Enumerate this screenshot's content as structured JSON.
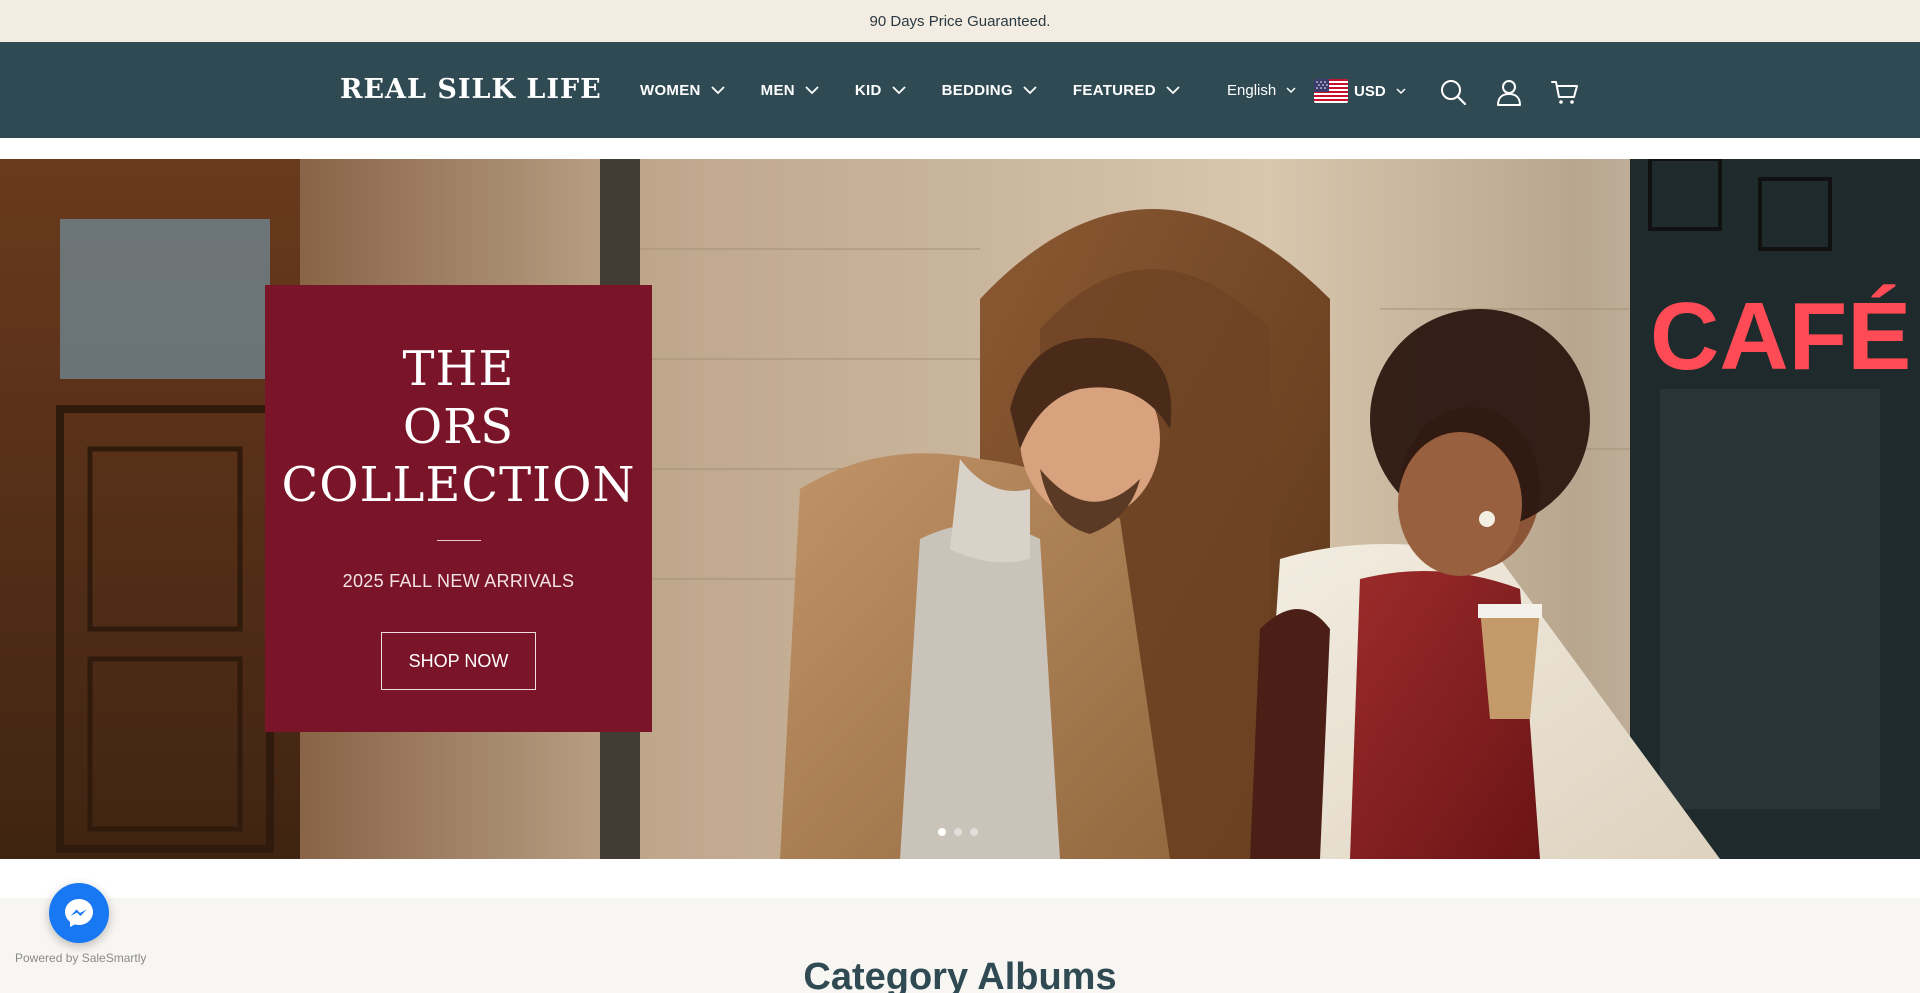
{
  "announcement": {
    "text": "90 Days Price Guaranteed."
  },
  "header": {
    "logo": "REAL SILK LIFE",
    "nav": [
      {
        "label": "WOMEN"
      },
      {
        "label": "MEN"
      },
      {
        "label": "KID"
      },
      {
        "label": "BEDDING"
      },
      {
        "label": "FEATURED"
      }
    ],
    "language": "English",
    "currency": "USD",
    "icons": [
      "search-icon",
      "account-icon",
      "cart-icon"
    ]
  },
  "hero": {
    "title_lines": [
      "THE",
      "ORS",
      "COLLECTION"
    ],
    "subtitle": "2025 FALL NEW ARRIVALS",
    "cta": "SHOP NOW",
    "sign_text": "CAFÉ",
    "slides_total": 3,
    "active_slide": 1
  },
  "section": {
    "title": "Category Albums"
  },
  "chat_widget": {
    "powered_by": "Powered by SaleSmartly",
    "icon": "messenger-icon"
  },
  "colors": {
    "announcement_bg": "#f3ece2",
    "header_bg": "#2f4a53",
    "promo_bg": "#7a1428",
    "messenger_blue": "#1877f2"
  }
}
